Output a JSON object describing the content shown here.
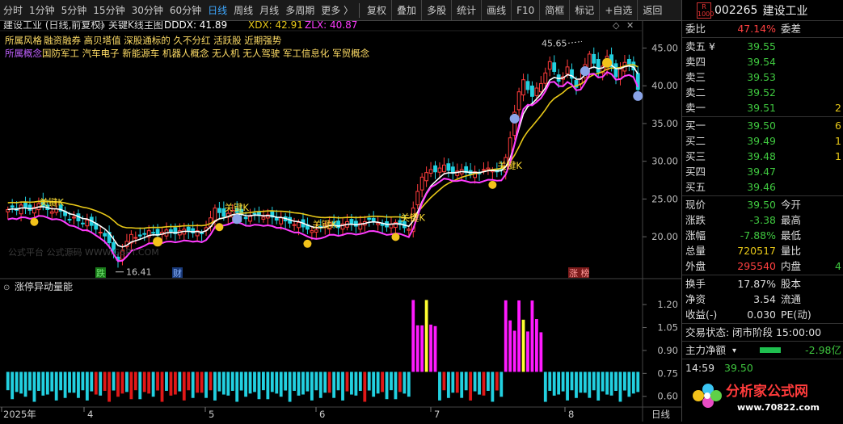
{
  "toolbar": {
    "periods": [
      "分时",
      "1分钟",
      "5分钟",
      "15分钟",
      "30分钟",
      "60分钟",
      "日线",
      "周线",
      "月线",
      "多周期",
      "更多 〉"
    ],
    "active_period": "日线",
    "tools": [
      "复权",
      "叠加",
      "多股",
      "统计",
      "画线",
      "F10",
      "简框",
      "标记",
      "+自选",
      "返回"
    ]
  },
  "chart": {
    "title": "建设工业 (日线,前复权)",
    "indicator_name": "关键K线主图",
    "dddx_label": "DDDX: 41.89",
    "xdx_label": "XDX: 42.91",
    "zlx_label": "ZLX: 40.87",
    "concept_row1_label": "所属风格",
    "concept_row1": "融资融券  高贝塔值  深股通标的  久不分红  活跃股  近期强势",
    "concept_row2_label": "所属概念",
    "concept_row2": "国防军工  汽车电子  新能源车  机器人概念  无人机  无人驾驶  军工信息化  军贸概念",
    "y_ticks": [
      "45.00",
      "40.00",
      "35.00",
      "30.00",
      "25.00",
      "20.00"
    ],
    "high_label": "45.65",
    "low_label": "16.41",
    "key_k_label": "关键K",
    "watermark": "公式平台  公式源码  WWW.GSPT.COM",
    "event_tags": [
      "跌",
      "财",
      "涨 榜"
    ],
    "sub_title": "涨停异动量能",
    "sub_ticks": [
      "1.20",
      "1.05",
      "0.90",
      "0.75",
      "0.60"
    ],
    "x_labels": [
      "2025年",
      "4",
      "5",
      "6",
      "7",
      "8"
    ],
    "period_label": "日线",
    "colors": {
      "candle_up": "#ff3c3c",
      "candle_down": "#22d0e0",
      "dddx": "#ffffff",
      "xdx": "#e8c818",
      "zlx": "#ff3cff",
      "bar_cyan": "#22d0e0",
      "bar_red": "#e01818",
      "bar_magenta": "#ff1aff",
      "bar_yellow": "#ffff30"
    }
  },
  "quote": {
    "code": "002265",
    "name": "建设工业",
    "badge": "R 1000",
    "weibi_label": "委比",
    "weibi": "47.14%",
    "weicha_label": "委差",
    "asks": [
      {
        "label": "卖五 ¥",
        "price": "39.55",
        "vol": ""
      },
      {
        "label": "卖四",
        "price": "39.54",
        "vol": ""
      },
      {
        "label": "卖三",
        "price": "39.53",
        "vol": ""
      },
      {
        "label": "卖二",
        "price": "39.52",
        "vol": ""
      },
      {
        "label": "卖一",
        "price": "39.51",
        "vol": "2"
      }
    ],
    "bids": [
      {
        "label": "买一",
        "price": "39.50",
        "vol": "6"
      },
      {
        "label": "买二",
        "price": "39.49",
        "vol": "1"
      },
      {
        "label": "买三",
        "price": "39.48",
        "vol": "1"
      },
      {
        "label": "买四",
        "price": "39.47",
        "vol": ""
      },
      {
        "label": "买五",
        "price": "39.46",
        "vol": ""
      }
    ],
    "stats": [
      {
        "l1": "现价",
        "v1": "39.50",
        "c1": "green",
        "l2": "今开",
        "v2": ""
      },
      {
        "l1": "涨跌",
        "v1": "-3.38",
        "c1": "green",
        "l2": "最高",
        "v2": ""
      },
      {
        "l1": "涨幅",
        "v1": "-7.88%",
        "c1": "green",
        "l2": "最低",
        "v2": ""
      },
      {
        "l1": "总量",
        "v1": "720517",
        "c1": "yellow",
        "l2": "量比",
        "v2": ""
      },
      {
        "l1": "外盘",
        "v1": "295540",
        "c1": "red",
        "l2": "内盘",
        "v2": "4"
      }
    ],
    "stats2": [
      {
        "l1": "换手",
        "v1": "17.87%",
        "l2": "股本"
      },
      {
        "l1": "净资",
        "v1": "3.54",
        "l2": "流通"
      },
      {
        "l1": "收益(-)",
        "v1": "0.030",
        "l2": "PE(动)"
      }
    ],
    "trade_status_label": "交易状态:",
    "trade_status": "闭市阶段 15:00:00",
    "main_net_label": "主力净额",
    "main_net_value": "-2.98亿",
    "last_time": "14:59",
    "last_price": "39.50",
    "logo_text": "分析家公式网",
    "logo_url": "www.70822.com"
  }
}
